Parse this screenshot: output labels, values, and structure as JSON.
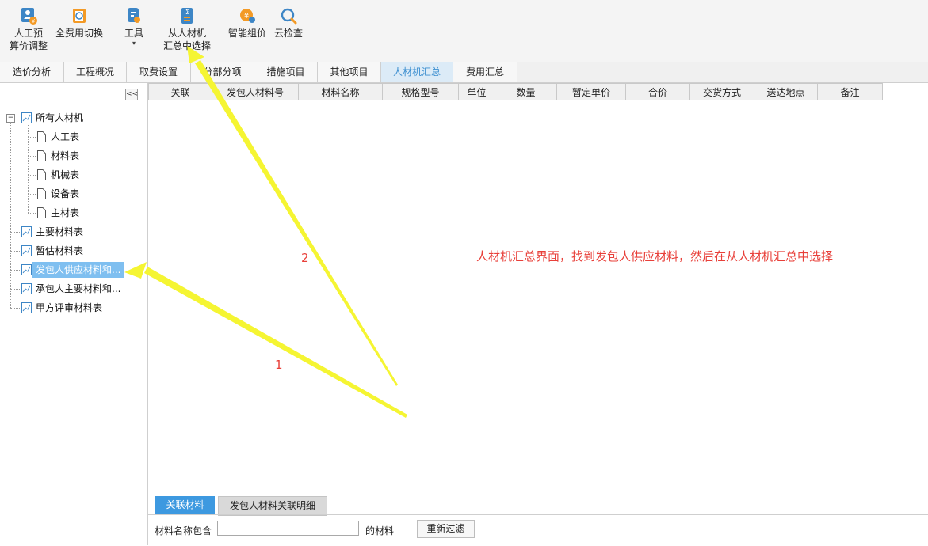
{
  "colors": {
    "accent": "#3d99e0",
    "annotation": "#e8403a",
    "arrow": "#f5f532",
    "selected": "#7fbff0"
  },
  "toolbar": {
    "buttons": [
      {
        "line1": "人工预",
        "line2": "算价调整",
        "icon": "user-price-icon"
      },
      {
        "line1": "全费用切换",
        "line2": "",
        "icon": "fee-switch-icon"
      },
      {
        "line1": "工具",
        "line2": "▾",
        "icon": "tools-icon"
      },
      {
        "line1": "从人材机",
        "line2": "汇总中选择",
        "icon": "select-summary-icon"
      },
      {
        "line1": "智能组价",
        "line2": "",
        "icon": "smart-price-icon"
      },
      {
        "line1": "云检查",
        "line2": "",
        "icon": "cloud-check-icon"
      }
    ]
  },
  "tabs": [
    "造价分析",
    "工程概况",
    "取费设置",
    "分部分项",
    "措施项目",
    "其他项目",
    "人材机汇总",
    "费用汇总"
  ],
  "active_tab": "人材机汇总",
  "tree": {
    "collapse_label": "<<",
    "expander": "−",
    "root": "所有人材机",
    "children": [
      "人工表",
      "材料表",
      "机械表",
      "设备表",
      "主材表"
    ],
    "others": [
      "主要材料表",
      "暂估材料表",
      "发包人供应材料和...",
      "承包人主要材料和...",
      "甲方评审材料表"
    ],
    "selected": "发包人供应材料和..."
  },
  "grid": {
    "columns": [
      "关联",
      "发包人材料号",
      "材料名称",
      "规格型号",
      "单位",
      "数量",
      "暂定单价",
      "合价",
      "交货方式",
      "送达地点",
      "备注"
    ]
  },
  "annotation": {
    "text": "人材机汇总界面，找到发包人供应材料，然后在从人材机汇总中选择",
    "arrow1": "1",
    "arrow2": "2"
  },
  "bottom": {
    "tabs": [
      "关联材料",
      "发包人材料关联明细"
    ],
    "filter_label": "材料名称包含",
    "filter_value": "",
    "filter_suffix": "的材料",
    "refilter_button": "重新过滤"
  }
}
